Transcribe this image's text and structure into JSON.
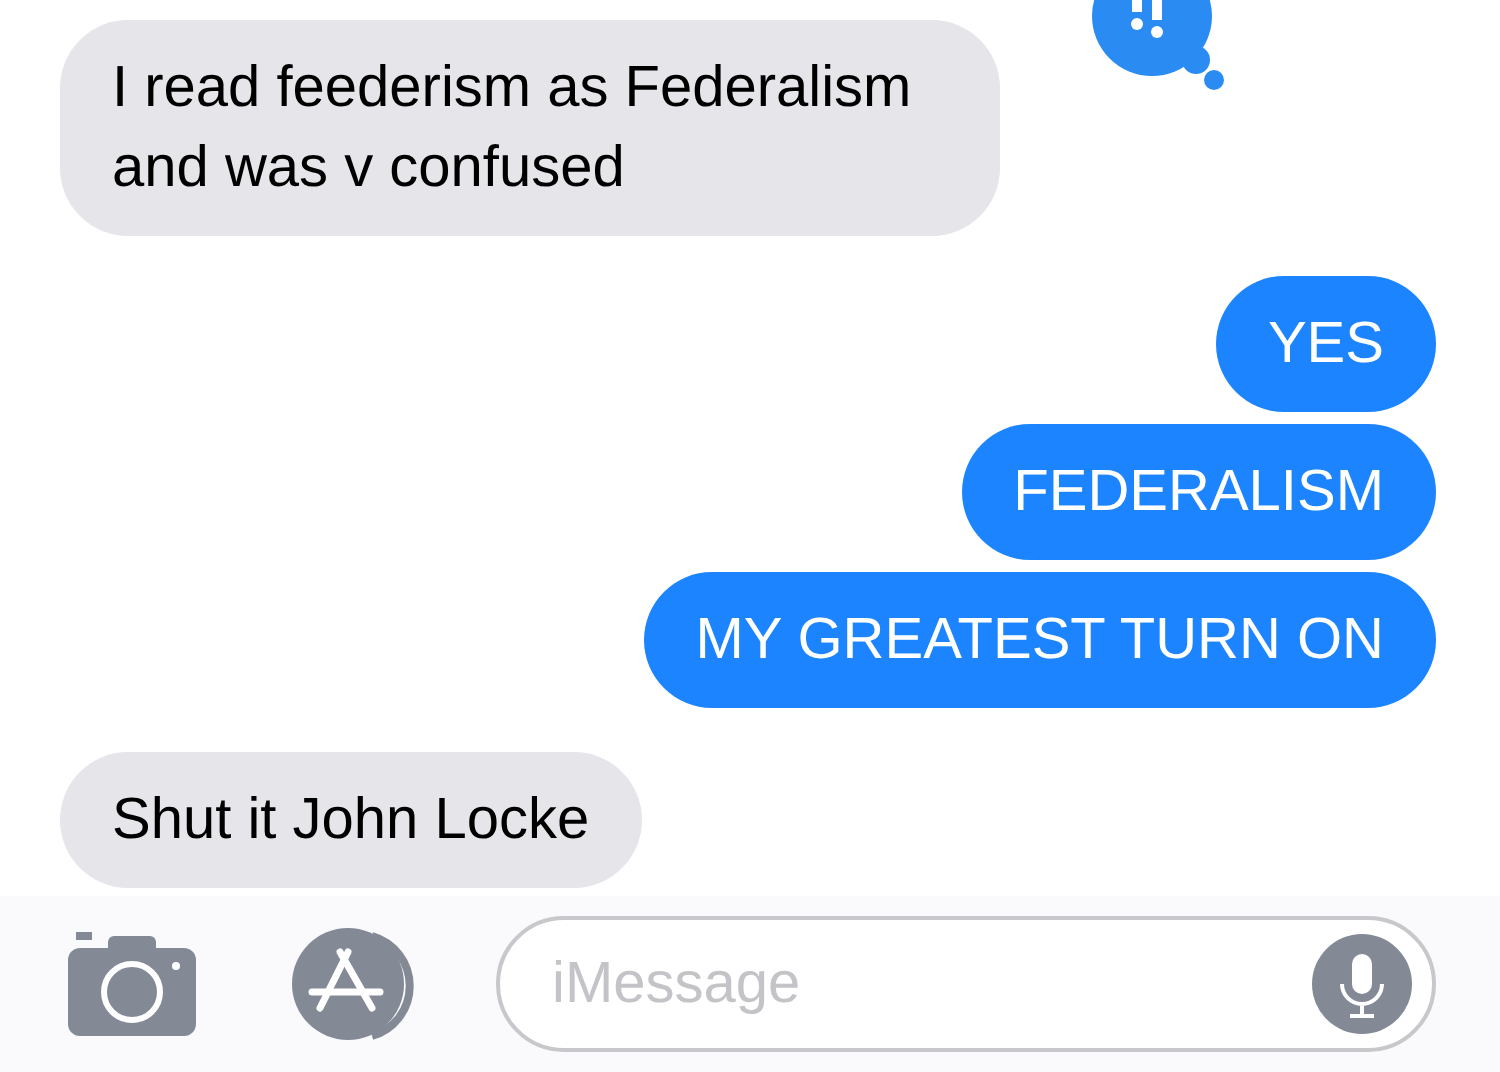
{
  "messages": [
    {
      "kind": "received",
      "text": "I read feederism as Federalism and was v confused",
      "reacted": true
    },
    {
      "kind": "sent",
      "text": "YES",
      "reacted": false
    },
    {
      "kind": "sent",
      "text": "FEDERALISM",
      "reacted": false
    },
    {
      "kind": "sent",
      "text": "MY GREATEST TURN ON",
      "reacted": false
    },
    {
      "kind": "received",
      "text": "Shut it John Locke",
      "reacted": false
    }
  ],
  "composer": {
    "placeholder": "iMessage"
  }
}
